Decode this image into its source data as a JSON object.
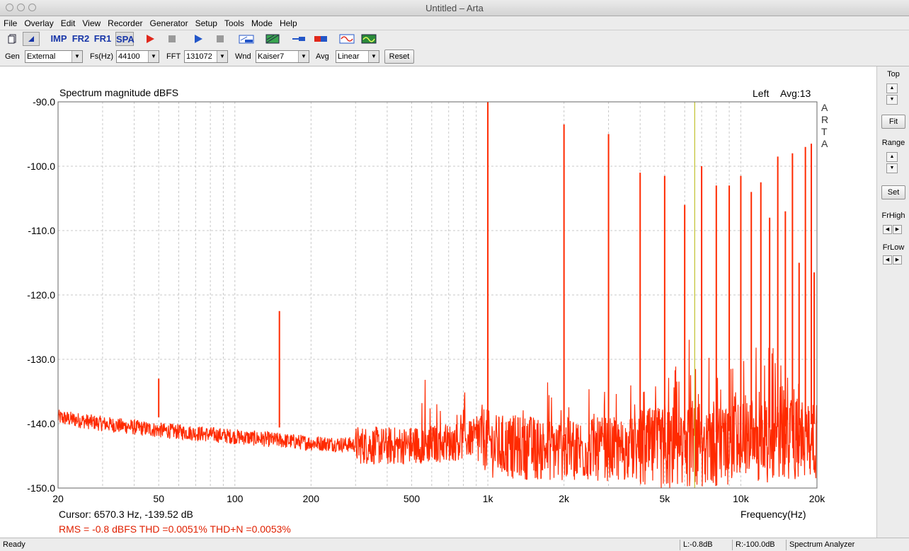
{
  "window": {
    "title": "Untitled – Arta"
  },
  "menu": [
    "File",
    "Overlay",
    "Edit",
    "View",
    "Recorder",
    "Generator",
    "Setup",
    "Tools",
    "Mode",
    "Help"
  ],
  "toolbar": {
    "text_buttons": [
      {
        "name": "impulse-mode-button",
        "label": "IMP"
      },
      {
        "name": "fr2-mode-button",
        "label": "FR2"
      },
      {
        "name": "fr1-mode-button",
        "label": "FR1"
      },
      {
        "name": "spa-mode-button",
        "label": "SPA"
      }
    ]
  },
  "controls": {
    "gen_label": "Gen",
    "gen_value": "External",
    "fs_label": "Fs(Hz)",
    "fs_value": "44100",
    "fft_label": "FFT",
    "fft_value": "131072",
    "wnd_label": "Wnd",
    "wnd_value": "Kaiser7",
    "avg_label": "Avg",
    "avg_value": "Linear",
    "reset_label": "Reset"
  },
  "side_panel": {
    "top_label": "Top",
    "fit_label": "Fit",
    "range_label": "Range",
    "set_label": "Set",
    "frhigh_label": "FrHigh",
    "frlow_label": "FrLow"
  },
  "plot_info": {
    "channel": "Left",
    "avg": "Avg:13",
    "logo": [
      "A",
      "R",
      "T",
      "A"
    ],
    "cursor": "Cursor:  6570.3 Hz, -139.52 dB",
    "rms": "RMS =   -0.8 dBFS   THD =0.0051%   THD+N =0.0053%"
  },
  "colors": {
    "trace": "#ff2a00",
    "cursor_line": "#b4b400",
    "rms_text": "#e02000",
    "grid": "#c8c8c8"
  },
  "status": {
    "ready": "Ready",
    "left": "L:-0.8dB",
    "right": "R:-100.0dB",
    "mode": "Spectrum Analyzer"
  },
  "chart_data": {
    "type": "line",
    "title": "Spectrum magnitude dBFS",
    "xlabel": "Frequency(Hz)",
    "ylabel": "",
    "x_scale": "log",
    "xlim": [
      20,
      20000
    ],
    "ylim": [
      -150,
      -90
    ],
    "x_ticks": [
      20,
      50,
      100,
      200,
      500,
      1000,
      2000,
      5000,
      10000,
      20000
    ],
    "x_tick_labels": [
      "20",
      "50",
      "100",
      "200",
      "500",
      "1k",
      "2k",
      "5k",
      "10k",
      "20k"
    ],
    "y_ticks": [
      -90,
      -100,
      -110,
      -120,
      -130,
      -140,
      -150
    ],
    "y_tick_labels": [
      "-90.0",
      "-100.0",
      "-110.0",
      "-120.0",
      "-130.0",
      "-140.0",
      "-150.0"
    ],
    "grid": true,
    "cursor_hz": 6570.3,
    "noise_floor": {
      "x": [
        20,
        30,
        50,
        100,
        200,
        400,
        700,
        950,
        1050,
        2000,
        5000,
        10000,
        20000
      ],
      "y": [
        -139,
        -140,
        -141,
        -142,
        -143,
        -143.5,
        -143,
        -142,
        -143.5,
        -144,
        -144,
        -143,
        -142
      ]
    },
    "series": [
      {
        "peaks_hz": [
          50,
          150,
          1000,
          2000,
          3000,
          4000,
          5000,
          6000,
          7000,
          8000,
          9000,
          10000,
          11000,
          12000,
          13000,
          14000,
          15000,
          16000,
          17000,
          18000,
          19000,
          19500
        ],
        "peaks_db": [
          -133,
          -122.5,
          -90,
          -93.5,
          -95,
          -101,
          -101.5,
          -106,
          -100,
          -103,
          -103,
          -101.5,
          -104,
          -102.5,
          -108,
          -98.5,
          -107,
          -98,
          -115,
          -97,
          -96.5,
          -116.5
        ]
      }
    ]
  }
}
